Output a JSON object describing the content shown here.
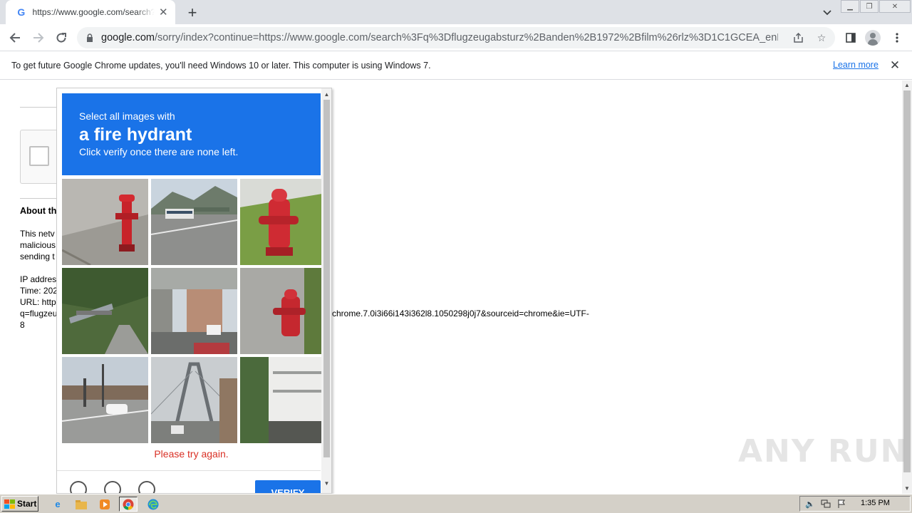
{
  "browser": {
    "tab": {
      "title": "https://www.google.com/search?q=",
      "favicon": "google-g-icon"
    },
    "new_tab_symbol": "+",
    "address": {
      "host": "google.com",
      "rest": "/sorry/index?continue=https://www.google.com/search%3Fq%3Dflugzeugabsturz%2Banden%2B1972%2Bfilm%26rlz%3D1C1GCEA_enDE1..."
    },
    "infobar": {
      "message": "To get future Google Chrome updates, you'll need Windows 10 or later. This computer is using Windows 7.",
      "link": "Learn more"
    }
  },
  "page": {
    "heading": "About th",
    "para_lines": [
      "This netv",
      "malicious",
      "sending t"
    ],
    "ip_lines": [
      "IP addres",
      "Time: 202",
      "URL: http"
    ],
    "url_line": "q=flugzeu",
    "url_tail": "chrome.7.0i3i66i143i362l8.1050298j0j7&sourceid=chrome&ie=UTF-",
    "url_last": "8"
  },
  "captcha": {
    "instruction": "Select all images with",
    "target": "a fire hydrant",
    "hint": "Click verify once there are none left.",
    "error": "Please try again.",
    "verify_label": "VERIFY",
    "tiles": [
      {
        "subject": "red-hydrant-on-pavement"
      },
      {
        "subject": "road-with-bus"
      },
      {
        "subject": "red-hydrant-on-grass"
      },
      {
        "subject": "hillside-highway"
      },
      {
        "subject": "city-street-overpass"
      },
      {
        "subject": "red-hydrant-by-wall"
      },
      {
        "subject": "intersection-with-car"
      },
      {
        "subject": "cable-bridge"
      },
      {
        "subject": "apartment-building"
      }
    ]
  },
  "watermark": "ANY RUN",
  "taskbar": {
    "start_label": "Start",
    "clock": "1:35 PM"
  }
}
